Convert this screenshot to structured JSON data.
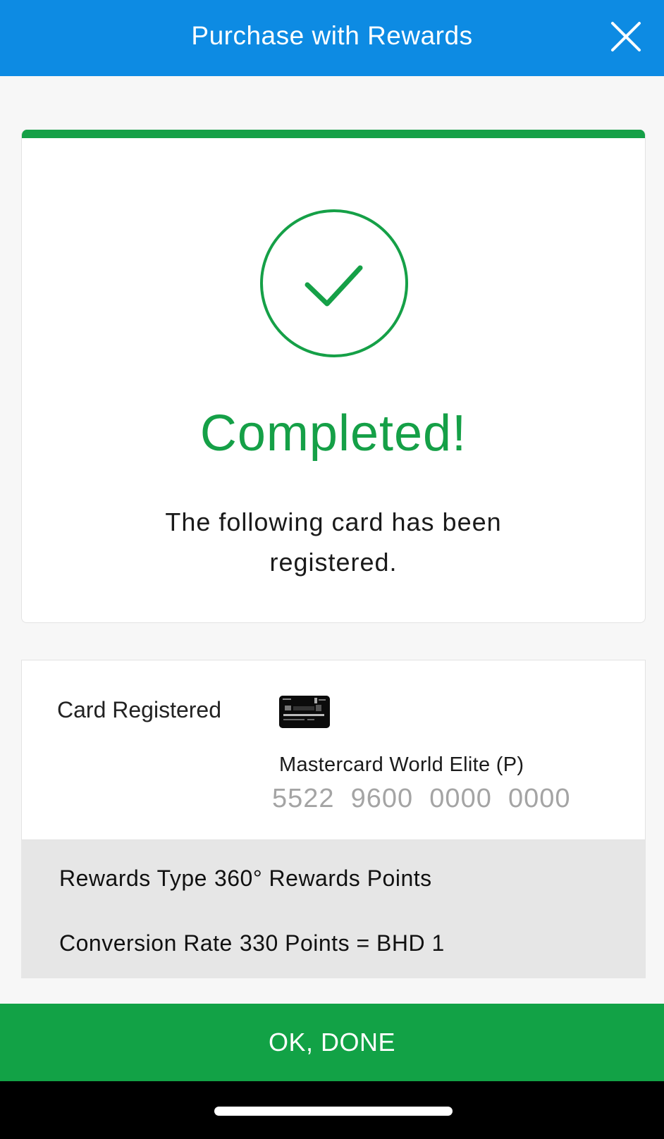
{
  "header": {
    "title": "Purchase with Rewards",
    "close_icon": "close-icon"
  },
  "status": {
    "icon": "checkmark-circle-icon",
    "title": "Completed!",
    "message": "The following card has been registered."
  },
  "card_details": {
    "label": "Card Registered",
    "card_image_icon": "credit-card-icon",
    "card_name": "Mastercard World Elite (P)",
    "card_number": "5522  9600  0000  0000"
  },
  "rewards_info": {
    "type_label": "Rewards Type",
    "type_value": "360° Rewards Points",
    "rate_label": "Conversion Rate",
    "rate_value": "330 Points = BHD 1"
  },
  "actions": {
    "ok_label": "OK, DONE"
  },
  "colors": {
    "header_bg": "#0d8be3",
    "success_green": "#15a047",
    "button_green": "#12a246",
    "panel_gray": "#e6e6e6"
  }
}
